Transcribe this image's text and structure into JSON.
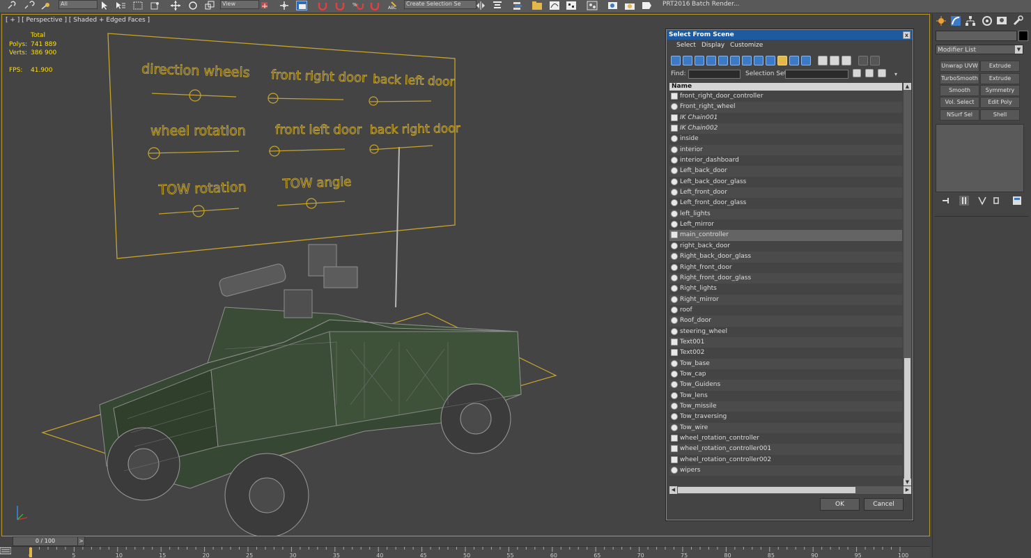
{
  "toolbar": {
    "filter_value": "All",
    "view_value": "View",
    "selection_set_placeholder": "Create Selection Se",
    "prt_label": "PRT2016",
    "batch_render_label": "Batch Render..."
  },
  "viewport": {
    "label": "[ + ] [ Perspective ] [ Shaded + Edged Faces ]",
    "stats": {
      "header": "Total",
      "polys_label": "Polys:",
      "polys_value": "741 889",
      "verts_label": "Verts:",
      "verts_value": "386 900",
      "fps_label": "FPS:",
      "fps_value": "41.900"
    },
    "panel_texts": {
      "direction_wheels": "direction wheels",
      "front_right_door": "front right door",
      "back_left_door": "back left door",
      "wheel_rotation": "wheel rotation",
      "front_left_door": "front left door",
      "back_right_door": "back right door",
      "tow_rotation": "TOW rotation",
      "tow_angle": "TOW angle"
    },
    "accent_color": "#c8a52a"
  },
  "dialog": {
    "title": "Select From Scene",
    "close_glyph": "x",
    "menu": [
      "Select",
      "Display",
      "Customize"
    ],
    "find_label": "Find:",
    "find_value": "",
    "selection_set_label": "Selection Set:",
    "column_header": "Name",
    "items": [
      {
        "name": "front_right_door_controller",
        "icon": "helper-icon",
        "italic": false,
        "selected": false
      },
      {
        "name": "Front_right_wheel",
        "icon": "geometry-icon",
        "italic": false,
        "selected": false
      },
      {
        "name": "IK Chain001",
        "icon": "ik-chain-icon",
        "italic": true,
        "selected": false
      },
      {
        "name": "IK Chain002",
        "icon": "ik-chain-icon",
        "italic": true,
        "selected": false
      },
      {
        "name": "inside",
        "icon": "geometry-icon",
        "italic": false,
        "selected": false
      },
      {
        "name": "interior",
        "icon": "geometry-icon",
        "italic": false,
        "selected": false
      },
      {
        "name": "interior_dashboard",
        "icon": "geometry-icon",
        "italic": false,
        "selected": false
      },
      {
        "name": "Left_back_door",
        "icon": "geometry-icon",
        "italic": false,
        "selected": false
      },
      {
        "name": "Left_back_door_glass",
        "icon": "geometry-icon",
        "italic": false,
        "selected": false
      },
      {
        "name": "Left_front_door",
        "icon": "geometry-icon",
        "italic": false,
        "selected": false
      },
      {
        "name": "Left_front_door_glass",
        "icon": "geometry-icon",
        "italic": false,
        "selected": false
      },
      {
        "name": "left_lights",
        "icon": "geometry-icon",
        "italic": false,
        "selected": false
      },
      {
        "name": "Left_mirror",
        "icon": "geometry-icon",
        "italic": false,
        "selected": false
      },
      {
        "name": "main_controller",
        "icon": "helper-icon",
        "italic": false,
        "selected": true
      },
      {
        "name": "right_back_door",
        "icon": "geometry-icon",
        "italic": false,
        "selected": false
      },
      {
        "name": "Right_back_door_glass",
        "icon": "geometry-icon",
        "italic": false,
        "selected": false
      },
      {
        "name": "Right_front_door",
        "icon": "geometry-icon",
        "italic": false,
        "selected": false
      },
      {
        "name": "Right_front_door_glass",
        "icon": "geometry-icon",
        "italic": false,
        "selected": false
      },
      {
        "name": "Right_lights",
        "icon": "geometry-icon",
        "italic": false,
        "selected": false
      },
      {
        "name": "Right_mirror",
        "icon": "geometry-icon",
        "italic": false,
        "selected": false
      },
      {
        "name": "roof",
        "icon": "geometry-icon",
        "italic": false,
        "selected": false
      },
      {
        "name": "Roof_door",
        "icon": "geometry-icon",
        "italic": false,
        "selected": false
      },
      {
        "name": "steering_wheel",
        "icon": "geometry-icon",
        "italic": false,
        "selected": false
      },
      {
        "name": "Text001",
        "icon": "shape-icon",
        "italic": false,
        "selected": false
      },
      {
        "name": "Text002",
        "icon": "shape-icon",
        "italic": false,
        "selected": false
      },
      {
        "name": "Tow_base",
        "icon": "geometry-icon",
        "italic": false,
        "selected": false
      },
      {
        "name": "Tow_cap",
        "icon": "geometry-icon",
        "italic": false,
        "selected": false
      },
      {
        "name": "Tow_Guidens",
        "icon": "geometry-icon",
        "italic": false,
        "selected": false
      },
      {
        "name": "Tow_lens",
        "icon": "geometry-icon",
        "italic": false,
        "selected": false
      },
      {
        "name": "Tow_missile",
        "icon": "geometry-icon",
        "italic": false,
        "selected": false
      },
      {
        "name": "Tow_traversing",
        "icon": "geometry-icon",
        "italic": false,
        "selected": false
      },
      {
        "name": "Tow_wire",
        "icon": "geometry-icon",
        "italic": false,
        "selected": false
      },
      {
        "name": "wheel_rotation_controller",
        "icon": "helper-icon",
        "italic": false,
        "selected": false
      },
      {
        "name": "wheel_rotation_controller001",
        "icon": "helper-icon",
        "italic": false,
        "selected": false
      },
      {
        "name": "wheel_rotation_controller002",
        "icon": "helper-icon",
        "italic": false,
        "selected": false
      },
      {
        "name": "wipers",
        "icon": "geometry-icon",
        "italic": false,
        "selected": false
      }
    ],
    "ok_label": "OK",
    "cancel_label": "Cancel",
    "title_bar_color": "#1d5aa0"
  },
  "command_panel": {
    "modifier_list_label": "Modifier List",
    "modifier_buttons": [
      "Unwrap UVW",
      "Extrude",
      "TurboSmooth",
      "Extrude",
      "Smooth",
      "Symmetry",
      "Vol. Select",
      "Edit Poly",
      "NSurf Sel",
      "Shell"
    ]
  },
  "timeline": {
    "frame_display": "0 / 100",
    "next_glyph": ">",
    "ticks": [
      "0",
      "5",
      "10",
      "15",
      "20",
      "25",
      "30",
      "35",
      "40",
      "45",
      "50",
      "55",
      "60",
      "65",
      "70",
      "75",
      "80",
      "85",
      "90",
      "95",
      "100"
    ]
  }
}
